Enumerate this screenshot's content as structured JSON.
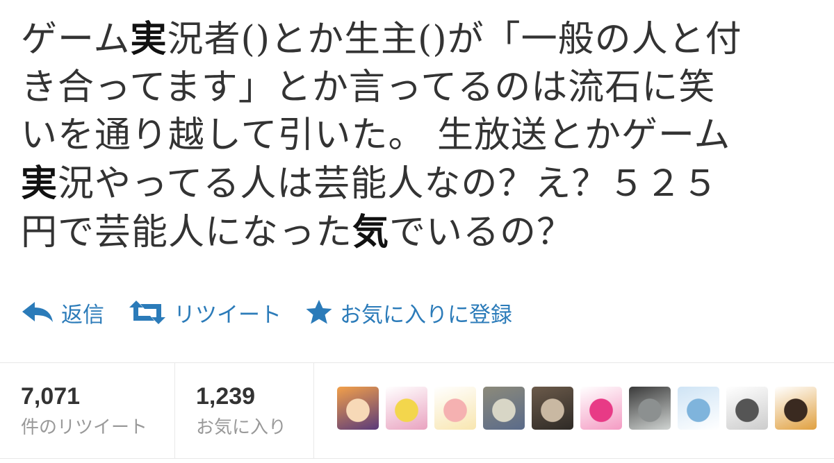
{
  "tweet": {
    "lines": [
      {
        "a": "ゲーム",
        "b": "実",
        "c": "況者()とか生主()が「一般の人と付"
      },
      {
        "a": "き合ってます」とか言ってるのは流石に笑",
        "b": "",
        "c": ""
      },
      {
        "a": "いを通り越して引いた。 生放送とかゲーム",
        "b": "",
        "c": ""
      },
      {
        "a": "",
        "b": "実",
        "c": "況やってる人は芸能人なの？え？５２５"
      },
      {
        "a": "円で芸能人になった",
        "b": "気",
        "c": "でいるの？"
      }
    ]
  },
  "actions": {
    "reply_label": "返信",
    "retweet_label": "リツイート",
    "favorite_label": "お気に入りに登録",
    "color": "#2b7bb9"
  },
  "stats": {
    "retweets": {
      "count": "7,071",
      "label": "件のリツイート"
    },
    "favorites": {
      "count": "1,239",
      "label": "お気に入り"
    }
  },
  "avatars": [
    {
      "name": "orange-hair-anime-avatar",
      "colors": [
        "#f2a04a",
        "#f7d9b7",
        "#5a3a7a"
      ]
    },
    {
      "name": "yellow-crescent-avatar",
      "colors": [
        "#ffffff",
        "#f3d64c",
        "#e9a3c0"
      ]
    },
    {
      "name": "pink-slice-avatar",
      "colors": [
        "#ffffff",
        "#f5b1b1",
        "#f8e6b0"
      ]
    },
    {
      "name": "round-dish-avatar",
      "colors": [
        "#8c8a7a",
        "#d8d6c6",
        "#5a6b8a"
      ]
    },
    {
      "name": "cat-photo-avatar",
      "colors": [
        "#6b5a4a",
        "#c9b8a2",
        "#2e2a26"
      ]
    },
    {
      "name": "pink-ball-avatar",
      "colors": [
        "#ffffff",
        "#e83a86",
        "#f49bc3"
      ]
    },
    {
      "name": "dark-photo-avatar",
      "colors": [
        "#3a3a3a",
        "#8c9090",
        "#d0d4d2"
      ]
    },
    {
      "name": "blue-hair-anime-avatar",
      "colors": [
        "#cfe4f5",
        "#7fb4dc",
        "#ffffff"
      ]
    },
    {
      "name": "sketch-character-avatar",
      "colors": [
        "#ffffff",
        "#555555",
        "#cccccc"
      ]
    },
    {
      "name": "guitar-character-avatar",
      "colors": [
        "#ffffff",
        "#3a2a20",
        "#e0a040"
      ]
    }
  ]
}
